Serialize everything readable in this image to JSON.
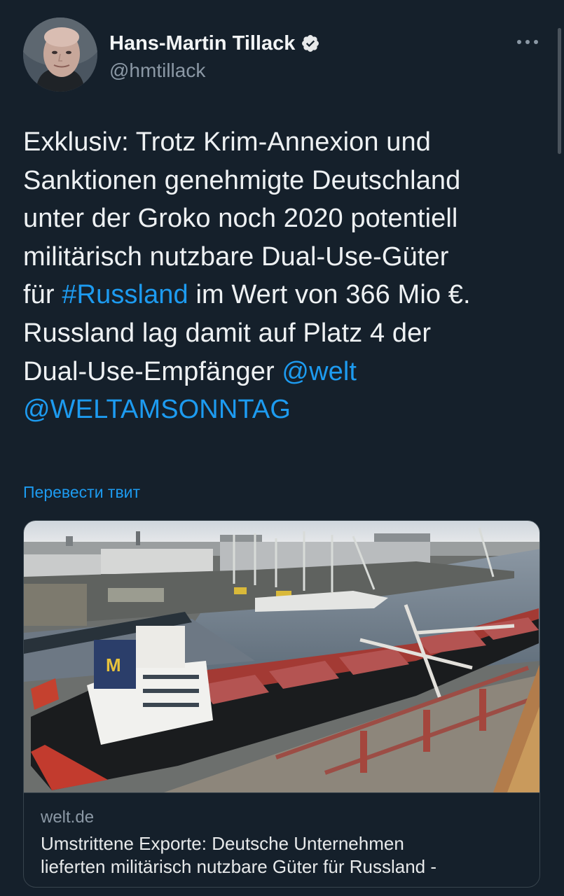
{
  "author": {
    "display_name": "Hans-Martin Tillack",
    "handle": "@hmtillack",
    "verified": true
  },
  "tweet": {
    "lines": [
      [
        {
          "text": "Exklusiv: Trotz Krim-Annexion und",
          "type": "text"
        }
      ],
      [
        {
          "text": "Sanktionen genehmigte Deutschland",
          "type": "text"
        }
      ],
      [
        {
          "text": "unter der Groko noch 2020 potentiell",
          "type": "text"
        }
      ],
      [
        {
          "text": "militärisch nutzbare Dual-Use-Güter",
          "type": "text"
        }
      ],
      [
        {
          "text": "für ",
          "type": "text"
        },
        {
          "text": "#Russland",
          "type": "hashtag"
        },
        {
          "text": " im Wert von 366 Mio €.",
          "type": "text"
        }
      ],
      [
        {
          "text": "Russland lag damit auf Platz 4 der",
          "type": "text"
        }
      ],
      [
        {
          "text": "Dual-Use-Empfänger ",
          "type": "text"
        },
        {
          "text": "@welt",
          "type": "mention"
        }
      ],
      [
        {
          "text": "@WELTAMSONNTAG",
          "type": "mention"
        }
      ]
    ]
  },
  "translate_label": "Перевести твит",
  "card": {
    "domain": "welt.de",
    "title_line1": "Umstrittene Exporte: Deutsche Unternehmen",
    "title_line2": "lieferten militärisch nutzbare Güter für Russland -",
    "image_alt": "Cargo ship docked at industrial harbor with cranes",
    "ship_logo_letter": "M"
  },
  "icons": {
    "verified": "verified-badge-icon",
    "more": "more-options-icon"
  },
  "colors": {
    "background": "#15202b",
    "link": "#1d9bf0",
    "muted": "#8b98a5",
    "text": "#e7e9ea"
  }
}
